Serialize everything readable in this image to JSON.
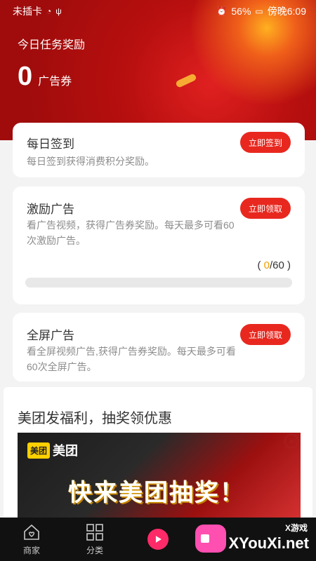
{
  "status_bar": {
    "carrier": "未插卡",
    "battery": "56%",
    "time": "傍晚6:09"
  },
  "header": {
    "title": "今日任务奖励",
    "count": "0",
    "unit": "广告券"
  },
  "tasks": [
    {
      "title": "每日签到",
      "desc": "每日签到获得消费积分奖励。",
      "button": "立即签到"
    },
    {
      "title": "激励广告",
      "desc": "看广告视频，获得广告券奖励。每天最多可看60次激励广告。",
      "button": "立即领取",
      "progress": {
        "open": "(",
        "current": "0",
        "sep": "/",
        "total": "60",
        "close": ")",
        "fraction": 0.0
      }
    },
    {
      "title": "全屏广告",
      "desc": "看全屏视频广告,获得广告券奖励。每天最多可看60次全屏广告。",
      "button": "立即领取"
    }
  ],
  "promo": {
    "title": "美团发福利，抽奖领优惠",
    "banner": {
      "logo_box": "美团",
      "logo_text": "美团",
      "headline": "快来美团抽奖！",
      "close": "×"
    }
  },
  "tabbar": {
    "items": [
      {
        "label": "商家",
        "icon": "home-icon"
      },
      {
        "label": "分类",
        "icon": "grid-icon"
      },
      {
        "label": "",
        "icon": "play-icon"
      }
    ]
  },
  "watermark": {
    "small": "X游戏",
    "big": "XYouXi.net"
  },
  "colors": {
    "accent": "#e8281f",
    "hero": "#b50f10",
    "progress": "#f0a000"
  }
}
